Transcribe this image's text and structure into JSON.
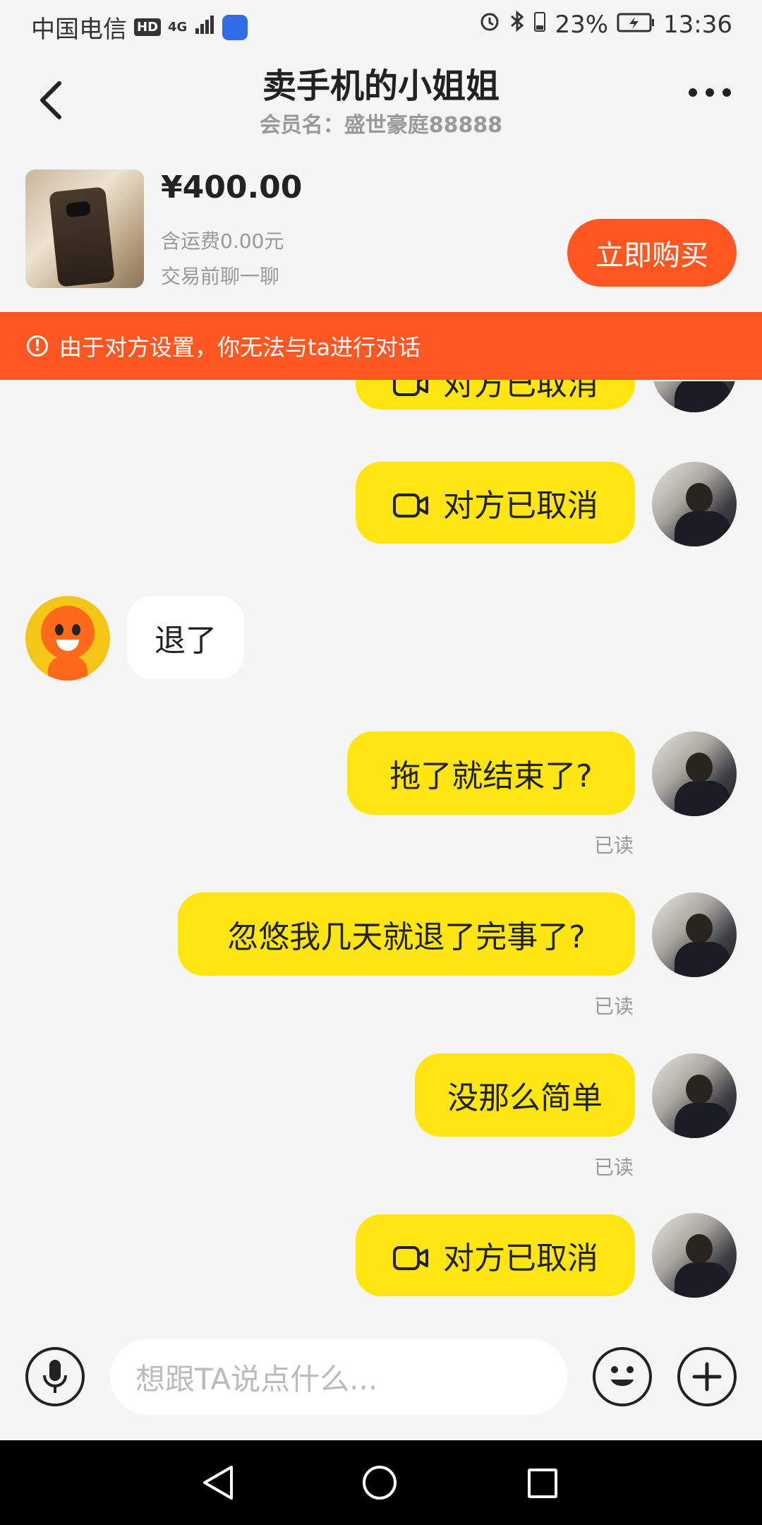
{
  "status_bar": {
    "carrier": "中国电信",
    "hd": "HD",
    "network": "4G",
    "battery": "23%",
    "time": "13:36"
  },
  "header": {
    "title": "卖手机的小姐姐",
    "subtitle": "会员名：盛世豪庭88888"
  },
  "product": {
    "price": "¥400.00",
    "shipping": "含运费0.00元",
    "chat_note": "交易前聊一聊",
    "buy_label": "立即购买"
  },
  "banner": {
    "text": "由于对方设置，你无法与ta进行对话"
  },
  "messages": [
    {
      "from": "me",
      "type": "video",
      "text": "对方已取消"
    },
    {
      "from": "me",
      "type": "video",
      "text": "对方已取消"
    },
    {
      "from": "seller",
      "type": "text",
      "text": "退了"
    },
    {
      "from": "me",
      "type": "text",
      "text": "拖了就结束了?",
      "status": "已读"
    },
    {
      "from": "me",
      "type": "text",
      "text": "忽悠我几天就退了完事了?",
      "status": "已读"
    },
    {
      "from": "me",
      "type": "text",
      "text": "没那么简单",
      "status": "已读"
    },
    {
      "from": "me",
      "type": "video",
      "text": "对方已取消"
    }
  ],
  "input": {
    "placeholder": "想跟TA说点什么..."
  },
  "colors": {
    "accent": "#ff5722",
    "bubble_me": "#ffe511",
    "bubble_other": "#ffffff"
  }
}
